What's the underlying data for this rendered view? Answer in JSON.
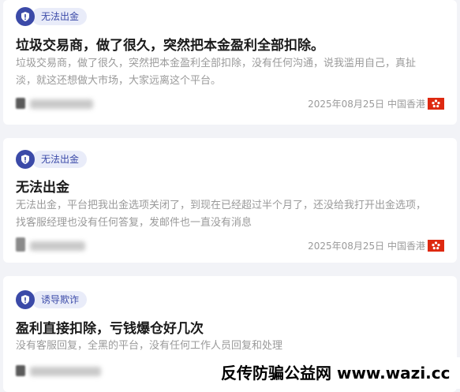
{
  "posts": [
    {
      "tag": "无法出金",
      "title": "垃圾交易商，做了很久，突然把本金盈利全部扣除。",
      "body": "垃圾交易商，做了很久，突然把本金盈利全部扣除，没有任何沟通，说我滥用自己，真扯淡，就这还想做大市场，大家远离这个平台。",
      "date": "2025年08月25日 中国香港",
      "flag": "hong-kong-flag"
    },
    {
      "tag": "无法出金",
      "title": "无法出金",
      "body": "无法出金，平台把我出金选项关闭了，到现在已经超过半个月了，还没给我打开出金选项，找客服经理也没有任何答复，发邮件也一直没有消息",
      "date": "2025年08月25日 中国香港",
      "flag": "hong-kong-flag"
    },
    {
      "tag": "诱导欺诈",
      "title": "盈利直接扣除，亏钱爆仓好几次",
      "body": "没有客服回复，全黑的平台，没有任何工作人员回复和处理"
    }
  ],
  "watermark": "反传防骗公益网 www.wazi.cc",
  "colors": {
    "accent": "#3b4aa8",
    "tag_bg": "#e9ecf9",
    "flag_red": "#de2910"
  }
}
